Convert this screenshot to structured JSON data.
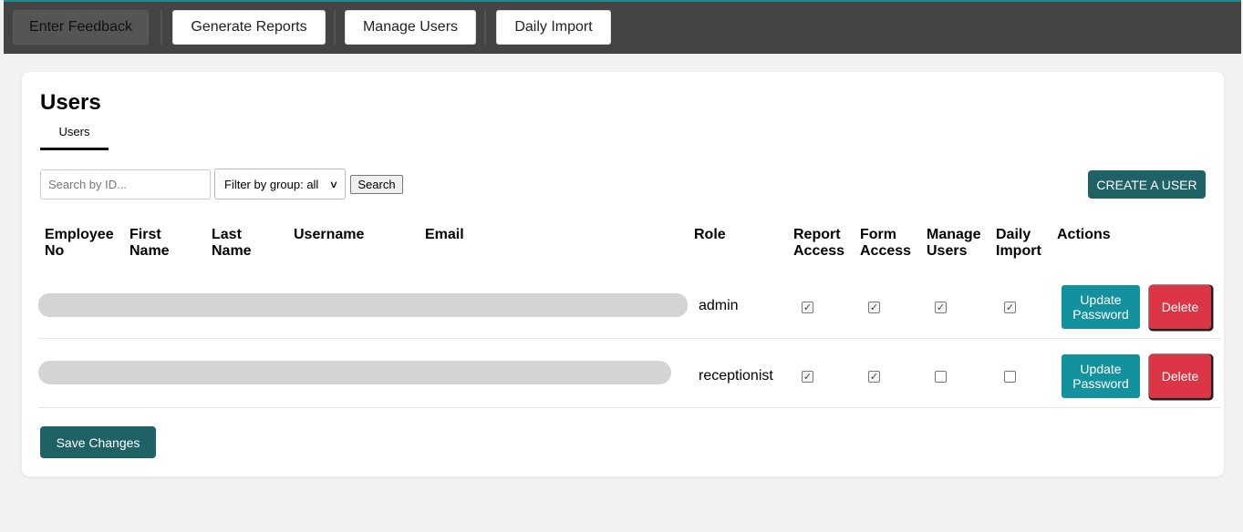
{
  "nav": {
    "items": [
      {
        "label": "Enter Feedback",
        "active": true
      },
      {
        "label": "Generate Reports",
        "active": false
      },
      {
        "label": "Manage Users",
        "active": false
      },
      {
        "label": "Daily Import",
        "active": false
      }
    ]
  },
  "page": {
    "title": "Users",
    "tab": "Users"
  },
  "filters": {
    "search_placeholder": "Search by ID...",
    "group_select_value": "Filter by group: all",
    "search_label": "Search",
    "create_label": "CREATE A USER"
  },
  "table": {
    "headers": [
      [
        "Employee",
        "No"
      ],
      [
        "First",
        "Name"
      ],
      [
        "Last",
        "Name"
      ],
      [
        "Username"
      ],
      [
        "Email"
      ],
      [
        "Role"
      ],
      [
        "Report",
        "Access"
      ],
      [
        "Form",
        "Access"
      ],
      [
        "Manage",
        "Users"
      ],
      [
        "Daily",
        "Import"
      ],
      [
        "Actions"
      ]
    ],
    "rows": [
      {
        "role": "admin",
        "report_access": true,
        "form_access": true,
        "manage_users": true,
        "daily_import": true
      },
      {
        "role": "receptionist",
        "report_access": true,
        "form_access": true,
        "manage_users": false,
        "daily_import": false
      }
    ],
    "update_password_label": "Update Password",
    "delete_label": "Delete"
  },
  "footer": {
    "save_label": "Save Changes"
  },
  "colors": {
    "topbar": "#444444",
    "accent_teal": "#1f6266",
    "update_btn": "#13919d",
    "delete_btn": "#dc3545"
  }
}
